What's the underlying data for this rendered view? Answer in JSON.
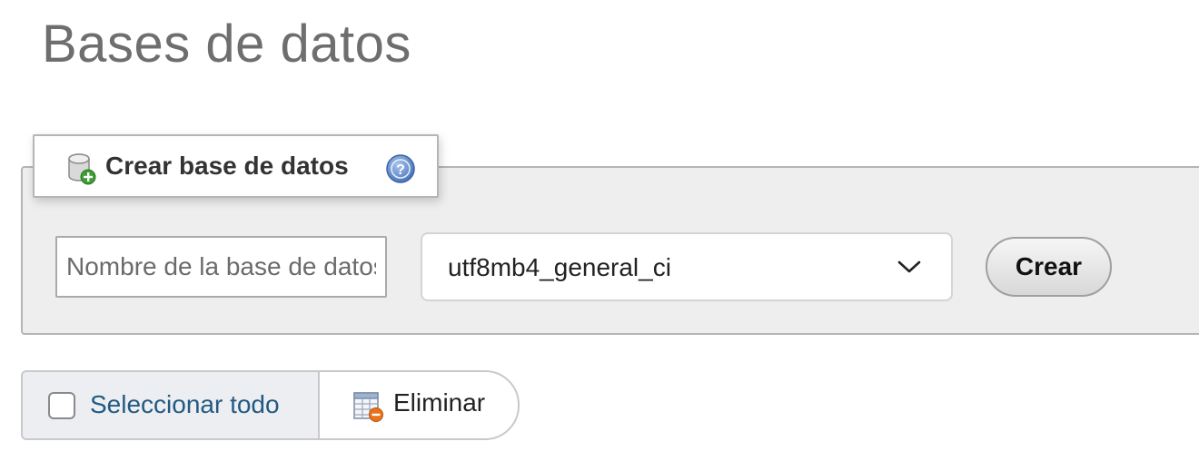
{
  "page": {
    "title": "Bases de datos"
  },
  "create_db": {
    "legend": "Crear base de datos",
    "icons": {
      "database": "database-add-icon",
      "help": "help-icon"
    },
    "name_input": {
      "value": "",
      "placeholder": "Nombre de la base de datos"
    },
    "collation": {
      "selected": "utf8mb4_general_ci",
      "icon": "chevron-down-icon"
    },
    "create_button": "Crear"
  },
  "bulk_actions": {
    "select_all_label": "Seleccionar todo",
    "delete_label": "Eliminar",
    "delete_icon": "table-delete-icon"
  },
  "colors": {
    "title": "#6e6e6e",
    "panel_bg": "#eeeeee",
    "link_blue": "#235a81",
    "help_blue": "#5b86c9",
    "add_green": "#3f9c35",
    "delete_orange": "#e8731c"
  }
}
